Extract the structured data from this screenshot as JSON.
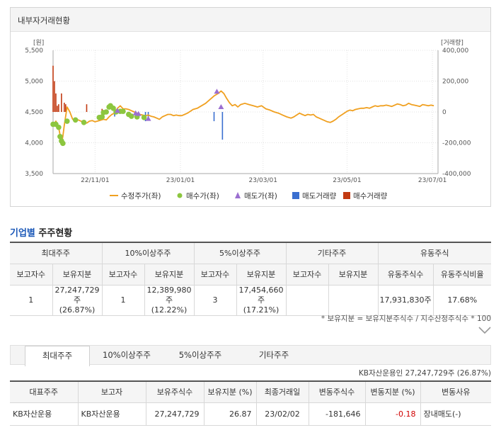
{
  "panel": {
    "title": "내부자거래현황"
  },
  "chart_data": {
    "type": "line",
    "left_axis": {
      "unit": "[원]",
      "ticks": [
        "5,500",
        "5,000",
        "4,500",
        "4,000",
        "3,500"
      ],
      "range": [
        3500,
        5500
      ]
    },
    "right_axis": {
      "unit": "[거래량]",
      "ticks": [
        "400,000",
        "200,000",
        "0",
        "-200,000",
        "-400,000"
      ],
      "range": [
        -400000,
        400000
      ]
    },
    "x_ticks": [
      {
        "label": "22/11/01",
        "x": 30
      },
      {
        "label": "23/01/01",
        "x": 91
      },
      {
        "label": "23/03/01",
        "x": 150
      },
      {
        "label": "23/05/01",
        "x": 210
      },
      {
        "label": "23/07/01",
        "x": 271
      }
    ],
    "x_range": [
      0,
      275
    ],
    "legend": [
      "수정주가(좌)",
      "매수가(좌)",
      "매도가(좌)",
      "매도거래량",
      "매수거래량"
    ],
    "colors": {
      "price": "#f0a020",
      "buy": "#8cc63f",
      "sell": "#9b6fd0",
      "sell_vol": "#3a6fd0",
      "buy_vol": "#c23a12"
    },
    "price": [
      [
        0,
        4280
      ],
      [
        2,
        4350
      ],
      [
        4,
        4250
      ],
      [
        6,
        4000
      ],
      [
        7,
        4100
      ],
      [
        8,
        4280
      ],
      [
        10,
        4580
      ],
      [
        12,
        4500
      ],
      [
        14,
        4380
      ],
      [
        16,
        4360
      ],
      [
        18,
        4370
      ],
      [
        21,
        4340
      ],
      [
        24,
        4320
      ],
      [
        26,
        4350
      ],
      [
        28,
        4360
      ],
      [
        30,
        4340
      ],
      [
        33,
        4360
      ],
      [
        36,
        4380
      ],
      [
        38,
        4370
      ],
      [
        40,
        4420
      ],
      [
        42,
        4460
      ],
      [
        44,
        4480
      ],
      [
        46,
        4560
      ],
      [
        48,
        4600
      ],
      [
        50,
        4550
      ],
      [
        52,
        4550
      ],
      [
        54,
        4540
      ],
      [
        56,
        4520
      ],
      [
        58,
        4500
      ],
      [
        60,
        4480
      ],
      [
        62,
        4460
      ],
      [
        64,
        4450
      ],
      [
        66,
        4440
      ],
      [
        68,
        4450
      ],
      [
        70,
        4430
      ],
      [
        72,
        4420
      ],
      [
        74,
        4400
      ],
      [
        76,
        4380
      ],
      [
        78,
        4420
      ],
      [
        80,
        4440
      ],
      [
        82,
        4460
      ],
      [
        84,
        4460
      ],
      [
        86,
        4440
      ],
      [
        88,
        4450
      ],
      [
        90,
        4440
      ],
      [
        92,
        4440
      ],
      [
        94,
        4460
      ],
      [
        96,
        4480
      ],
      [
        98,
        4510
      ],
      [
        100,
        4540
      ],
      [
        103,
        4560
      ],
      [
        106,
        4600
      ],
      [
        109,
        4640
      ],
      [
        112,
        4700
      ],
      [
        115,
        4760
      ],
      [
        118,
        4800
      ],
      [
        120,
        4840
      ],
      [
        122,
        4800
      ],
      [
        124,
        4720
      ],
      [
        126,
        4650
      ],
      [
        128,
        4600
      ],
      [
        130,
        4620
      ],
      [
        132,
        4580
      ],
      [
        134,
        4620
      ],
      [
        137,
        4640
      ],
      [
        140,
        4620
      ],
      [
        143,
        4600
      ],
      [
        146,
        4580
      ],
      [
        149,
        4600
      ],
      [
        152,
        4550
      ],
      [
        155,
        4530
      ],
      [
        158,
        4500
      ],
      [
        161,
        4480
      ],
      [
        164,
        4450
      ],
      [
        167,
        4420
      ],
      [
        170,
        4400
      ],
      [
        172,
        4420
      ],
      [
        174,
        4450
      ],
      [
        176,
        4480
      ],
      [
        178,
        4460
      ],
      [
        180,
        4440
      ],
      [
        182,
        4460
      ],
      [
        184,
        4450
      ],
      [
        186,
        4460
      ],
      [
        188,
        4420
      ],
      [
        190,
        4400
      ],
      [
        192,
        4380
      ],
      [
        194,
        4360
      ],
      [
        196,
        4340
      ],
      [
        198,
        4330
      ],
      [
        200,
        4350
      ],
      [
        202,
        4380
      ],
      [
        204,
        4420
      ],
      [
        206,
        4450
      ],
      [
        208,
        4480
      ],
      [
        210,
        4510
      ],
      [
        212,
        4530
      ],
      [
        214,
        4520
      ],
      [
        216,
        4540
      ],
      [
        218,
        4550
      ],
      [
        220,
        4560
      ],
      [
        222,
        4560
      ],
      [
        224,
        4570
      ],
      [
        226,
        4560
      ],
      [
        228,
        4580
      ],
      [
        230,
        4600
      ],
      [
        232,
        4590
      ],
      [
        234,
        4600
      ],
      [
        236,
        4600
      ],
      [
        238,
        4610
      ],
      [
        240,
        4600
      ],
      [
        242,
        4590
      ],
      [
        244,
        4610
      ],
      [
        246,
        4630
      ],
      [
        248,
        4620
      ],
      [
        250,
        4600
      ],
      [
        252,
        4610
      ],
      [
        254,
        4640
      ],
      [
        256,
        4620
      ],
      [
        258,
        4610
      ],
      [
        260,
        4600
      ],
      [
        262,
        4590
      ],
      [
        264,
        4620
      ],
      [
        266,
        4610
      ],
      [
        268,
        4600
      ],
      [
        270,
        4610
      ],
      [
        272,
        4600
      ]
    ],
    "buy_points": [
      [
        0,
        4300
      ],
      [
        2,
        4300
      ],
      [
        4,
        4250
      ],
      [
        5,
        4100
      ],
      [
        6,
        4030
      ],
      [
        7,
        3990
      ],
      [
        10,
        4350
      ],
      [
        16,
        4370
      ],
      [
        22,
        4330
      ],
      [
        33,
        4410
      ],
      [
        35,
        4420
      ],
      [
        36,
        4490
      ],
      [
        38,
        4500
      ],
      [
        40,
        4580
      ],
      [
        41,
        4600
      ],
      [
        43,
        4560
      ],
      [
        45,
        4500
      ],
      [
        48,
        4510
      ],
      [
        50,
        4510
      ],
      [
        54,
        4460
      ],
      [
        56,
        4430
      ],
      [
        60,
        4420
      ],
      [
        65,
        4410
      ]
    ],
    "sell_points": [
      [
        46,
        4520
      ],
      [
        59,
        4480
      ],
      [
        61,
        4470
      ],
      [
        68,
        4390
      ],
      [
        117,
        4830
      ],
      [
        120,
        4580
      ]
    ],
    "sell_volumes": [
      [
        44,
        -30000
      ],
      [
        66,
        -60000
      ],
      [
        68,
        -50000
      ],
      [
        115,
        -60000
      ],
      [
        121,
        -180000
      ]
    ],
    "buy_volumes": [
      [
        0,
        300000
      ],
      [
        1,
        200000
      ],
      [
        2,
        120000
      ],
      [
        3,
        40000
      ],
      [
        4,
        50000
      ],
      [
        6,
        120000
      ],
      [
        8,
        60000
      ],
      [
        9,
        50000
      ],
      [
        24,
        50000
      ],
      [
        35,
        20000
      ]
    ]
  },
  "ownership": {
    "title_blue": "기업별",
    "title_rest": " 주주현황",
    "groups": [
      "최대주주",
      "10%이상주주",
      "5%이상주주",
      "기타주주",
      "유동주식"
    ],
    "subheaders": [
      "보고자수",
      "보유지분",
      "보고자수",
      "보유지분",
      "보고자수",
      "보유지분",
      "보고자수",
      "보유지분",
      "유동주식수",
      "유동주식비율"
    ],
    "row": {
      "max_count": "1",
      "max_shares": "27,247,729주",
      "max_pct": "(26.87%)",
      "ten_count": "1",
      "ten_shares": "12,389,980주",
      "ten_pct": "(12.22%)",
      "five_count": "3",
      "five_shares": "17,454,660주",
      "five_pct": "(17.21%)",
      "etc_count": "",
      "etc_shares": "",
      "float_shares": "17,931,830주",
      "float_ratio": "17.68%"
    },
    "note": "* 보유지분 = 보유지분주식수 / 지수산정주식수 * 100"
  },
  "tabs": [
    "최대주주",
    "10%이상주주",
    "5%이상주주",
    "기타주주"
  ],
  "holder_summary": "KB자산운용인 27,247,729주 (26.87%)",
  "detail": {
    "headers": [
      "대표주주",
      "보고자",
      "보유주식수",
      "보유지분 (%)",
      "최종거래일",
      "변동주식수",
      "변동지분 (%)",
      "변동사유"
    ],
    "row": {
      "rep": "KB자산운용",
      "reporter": "KB자산운용",
      "shares": "27,247,729",
      "pct": "26.87",
      "last_date": "23/02/02",
      "change_shares": "-181,646",
      "change_pct": "-0.18",
      "reason": "장내매도(-)"
    }
  }
}
